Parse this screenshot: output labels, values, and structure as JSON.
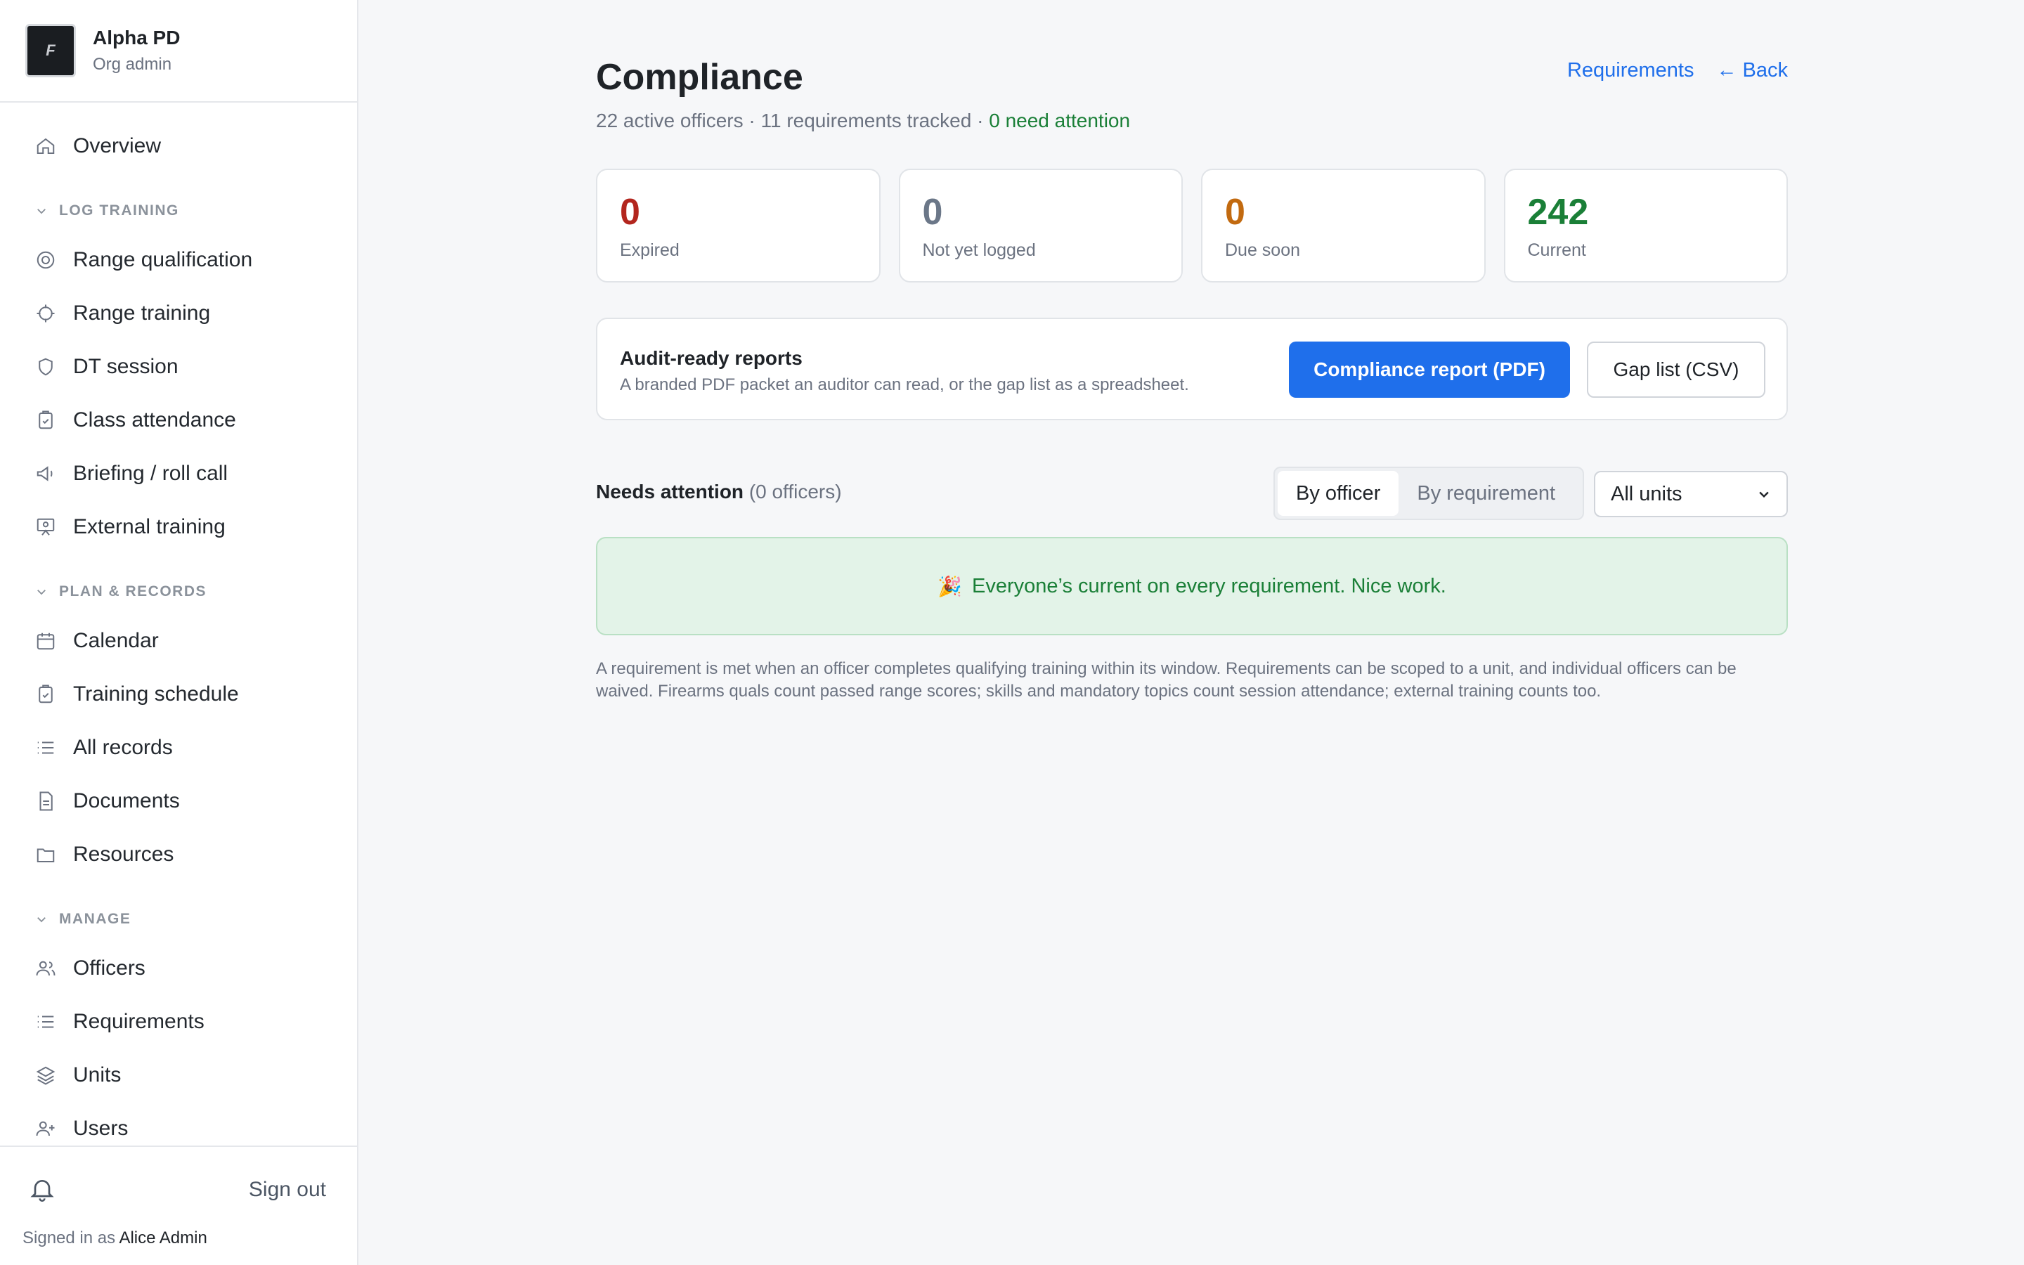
{
  "org": {
    "name": "Alpha PD",
    "role": "Org admin",
    "logo_glyph": "F"
  },
  "sidebar": {
    "overview": {
      "label": "Overview",
      "icon": "home-icon"
    },
    "sections": [
      {
        "title": "LOG TRAINING",
        "items": [
          {
            "label": "Range qualification",
            "icon": "target-icon"
          },
          {
            "label": "Range training",
            "icon": "crosshair-icon"
          },
          {
            "label": "DT session",
            "icon": "shield-icon"
          },
          {
            "label": "Class attendance",
            "icon": "clipboard-icon"
          },
          {
            "label": "Briefing / roll call",
            "icon": "megaphone-icon"
          },
          {
            "label": "External training",
            "icon": "presentation-icon"
          }
        ]
      },
      {
        "title": "PLAN & RECORDS",
        "items": [
          {
            "label": "Calendar",
            "icon": "calendar-icon"
          },
          {
            "label": "Training schedule",
            "icon": "clipboard-icon"
          },
          {
            "label": "All records",
            "icon": "list-icon"
          },
          {
            "label": "Documents",
            "icon": "document-icon"
          },
          {
            "label": "Resources",
            "icon": "folder-icon"
          }
        ]
      },
      {
        "title": "MANAGE",
        "items": [
          {
            "label": "Officers",
            "icon": "users-icon"
          },
          {
            "label": "Requirements",
            "icon": "list-icon"
          },
          {
            "label": "Units",
            "icon": "layers-icon"
          },
          {
            "label": "Users",
            "icon": "user-plus-icon"
          }
        ]
      }
    ],
    "footer": {
      "signout": "Sign out",
      "signed_in_prefix": "Signed in as",
      "user": "Alice Admin"
    }
  },
  "page": {
    "title": "Compliance",
    "subtitle_prefix": "22 active officers · 11 requirements tracked · ",
    "subtitle_status": "0 need attention",
    "links": {
      "requirements": "Requirements",
      "back": "← Back"
    }
  },
  "stats": [
    {
      "value": "0",
      "label": "Expired",
      "color": "#b3261e"
    },
    {
      "value": "0",
      "label": "Not yet logged",
      "color": "#6b7788"
    },
    {
      "value": "0",
      "label": "Due soon",
      "color": "#c26a10"
    },
    {
      "value": "242",
      "label": "Current",
      "color": "#1a7f37"
    }
  ],
  "reports": {
    "title": "Audit-ready reports",
    "description": "A branded PDF packet an auditor can read, or the gap list as a spreadsheet.",
    "primary_button": "Compliance report (PDF)",
    "secondary_button": "Gap list (CSV)"
  },
  "attention": {
    "heading": "Needs attention",
    "count": "(0 officers)",
    "tabs": [
      "By officer",
      "By requirement"
    ],
    "active_tab": "By officer",
    "unit_filter": "All units",
    "success_emoji": "🎉",
    "success_message": "Everyone’s current on every requirement. Nice work."
  },
  "footnote": "A requirement is met when an officer completes qualifying training within its window. Requirements can be scoped to a unit, and individual officers can be waived. Firearms quals count passed range scores; skills and mandatory topics count session attendance; external training counts too."
}
